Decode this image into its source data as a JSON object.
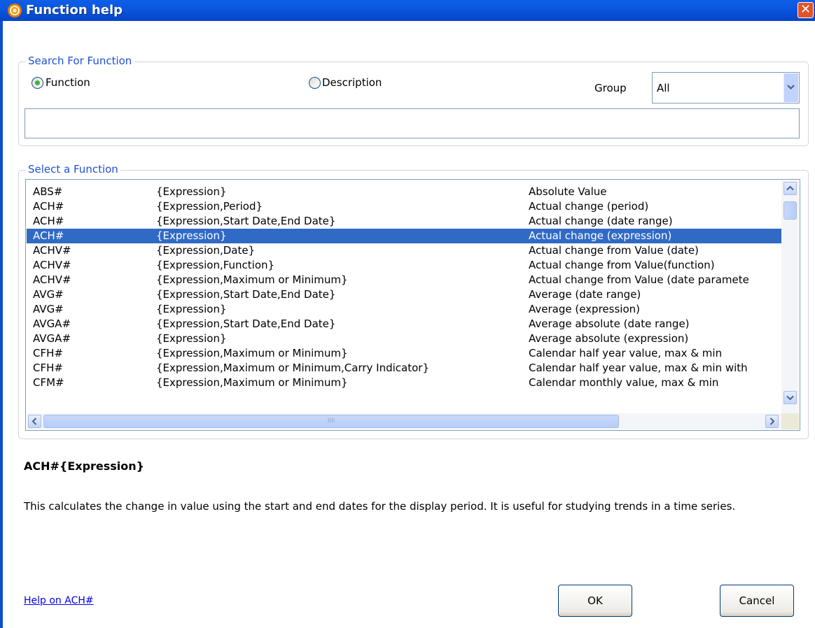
{
  "window": {
    "title": "Function help",
    "close_label": "✕"
  },
  "search": {
    "legend": "Search For Function",
    "radio_function_label": "Function",
    "radio_description_label": "Description",
    "selected_mode": "Function",
    "group_label": "Group",
    "group_value": "All",
    "search_value": ""
  },
  "list": {
    "legend": "Select a Function",
    "selected_index": 3,
    "rows": [
      {
        "name": "ABS#",
        "params": "{Expression}",
        "desc": "Absolute Value"
      },
      {
        "name": "ACH#",
        "params": "{Expression,Period}",
        "desc": "Actual change (period)"
      },
      {
        "name": "ACH#",
        "params": "{Expression,Start Date,End Date}",
        "desc": "Actual change (date range)"
      },
      {
        "name": "ACH#",
        "params": "{Expression}",
        "desc": "Actual change (expression)"
      },
      {
        "name": "ACHV#",
        "params": "{Expression,Date}",
        "desc": "Actual change from Value (date)"
      },
      {
        "name": "ACHV#",
        "params": "{Expression,Function}",
        "desc": "Actual change from Value(function)"
      },
      {
        "name": "ACHV#",
        "params": "{Expression,Maximum or Minimum}",
        "desc": "Actual change from Value (date paramete"
      },
      {
        "name": "AVG#",
        "params": "{Expression,Start Date,End Date}",
        "desc": "Average (date range)"
      },
      {
        "name": "AVG#",
        "params": "{Expression}",
        "desc": "Average (expression)"
      },
      {
        "name": "AVGA#",
        "params": "{Expression,Start Date,End Date}",
        "desc": "Average absolute (date range)"
      },
      {
        "name": "AVGA#",
        "params": "{Expression}",
        "desc": "Average absolute (expression)"
      },
      {
        "name": "CFH#",
        "params": "{Expression,Maximum or Minimum}",
        "desc": "Calendar half year value, max & min"
      },
      {
        "name": "CFH#",
        "params": "{Expression,Maximum or Minimum,Carry Indicator}",
        "desc": "Calendar half year value, max & min with"
      },
      {
        "name": "CFM#",
        "params": "{Expression,Maximum or Minimum}",
        "desc": "Calendar monthly value, max & min"
      }
    ],
    "hscroll_grip": "IIII"
  },
  "details": {
    "title": "ACH#{Expression}",
    "body": "This calculates the change in value using the start and end dates for the display period. It is useful for studying trends in a time series."
  },
  "footer": {
    "help_link": "Help on ACH#",
    "ok_label": "OK",
    "cancel_label": "Cancel"
  },
  "icons": [
    "app-icon",
    "close-icon",
    "chevron-down-icon",
    "scroll-up-icon",
    "scroll-down-icon",
    "scroll-left-icon",
    "scroll-right-icon"
  ],
  "colors": {
    "titlebar": "#0a57df",
    "selection": "#316ac5",
    "legend": "#2050d0",
    "close": "#e2532c"
  }
}
